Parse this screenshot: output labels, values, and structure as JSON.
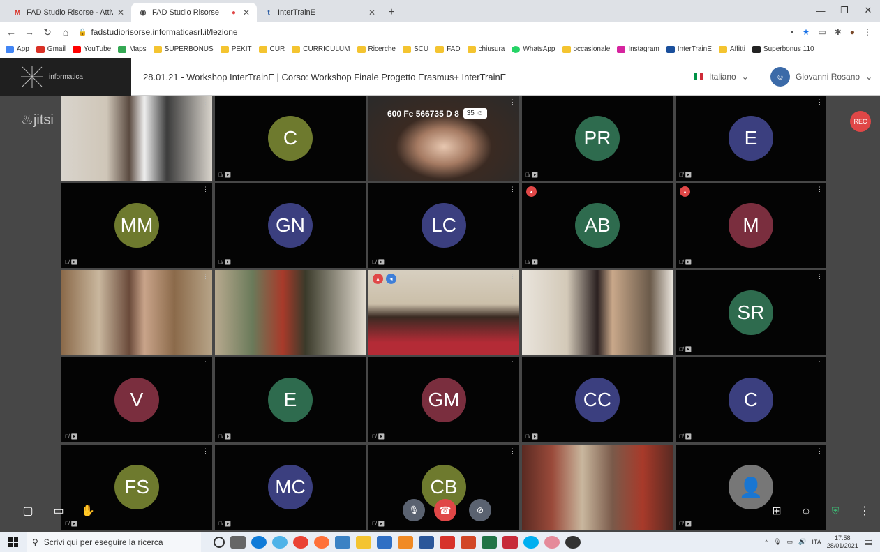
{
  "browser": {
    "tabs": [
      {
        "label": "FAD Studio Risorse - Attivazione",
        "favicon": "gmail-icon",
        "active": false
      },
      {
        "label": "FAD Studio Risorse",
        "favicon": "page-icon",
        "active": true
      },
      {
        "label": "InterTrainE",
        "favicon": "intertraine-icon",
        "active": false
      }
    ],
    "url": "fadstudiorisorse.informaticasrl.it/lezione",
    "bookmarks": [
      "App",
      "Gmail",
      "YouTube",
      "Maps",
      "SUPERBONUS",
      "PEKIT",
      "CUR",
      "CURRICULUM",
      "Ricerche",
      "SCU",
      "FAD",
      "chiusura",
      "WhatsApp",
      "occasionale",
      "Instagram",
      "InterTrainE",
      "Affitti",
      "Superbonus 110"
    ]
  },
  "header": {
    "logo_text": "informatica",
    "course_title": "28.01.21 - Workshop InterTrainE | Corso: Workshop Finale Progetto Erasmus+ InterTrainE",
    "language": "Italiano",
    "user_name": "Giovanni Rosano"
  },
  "meeting": {
    "brand": "jitsi",
    "rec_label": "REC",
    "participant_overlay": "600 Fe 566735 D 8",
    "participant_count": "35",
    "tiles": [
      {
        "initials": "",
        "color": "#2a2a2a",
        "video": "woman-mask"
      },
      {
        "initials": "C",
        "color": "#6e7a2e"
      },
      {
        "initials": "",
        "color": "#2a2a2a",
        "video": "woman"
      },
      {
        "initials": "PR",
        "color": "#2e6b4e"
      },
      {
        "initials": "E",
        "color": "#3b3f7f"
      },
      {
        "initials": "MM",
        "color": "#6e7a2e"
      },
      {
        "initials": "GN",
        "color": "#3b3f7f"
      },
      {
        "initials": "LC",
        "color": "#3b3f7f"
      },
      {
        "initials": "AB",
        "color": "#2e6b4e"
      },
      {
        "initials": "M",
        "color": "#7a2e3e"
      },
      {
        "initials": "",
        "color": "#2a2a2a",
        "video": "man-books"
      },
      {
        "initials": "",
        "color": "#2a2a2a",
        "video": "woman-hat"
      },
      {
        "initials": "",
        "color": "#2a2a2a",
        "video": "woman-speaking"
      },
      {
        "initials": "",
        "color": "#2a2a2a",
        "video": "woman-office"
      },
      {
        "initials": "SR",
        "color": "#2e6b4e"
      },
      {
        "initials": "V",
        "color": "#7a2e3e"
      },
      {
        "initials": "E",
        "color": "#2e6b4e"
      },
      {
        "initials": "GM",
        "color": "#7a2e3e"
      },
      {
        "initials": "CC",
        "color": "#3b3f7f"
      },
      {
        "initials": "C",
        "color": "#3b3f7f"
      },
      {
        "initials": "FS",
        "color": "#6e7a2e"
      },
      {
        "initials": "MC",
        "color": "#3b3f7f"
      },
      {
        "initials": "CB",
        "color": "#6e7a2e"
      },
      {
        "initials": "",
        "color": "#2a2a2a",
        "video": "woman-library"
      },
      {
        "initials": "",
        "color": "#777777",
        "video": "placeholder"
      }
    ]
  },
  "taskbar": {
    "search_placeholder": "Scrivi qui per eseguire la ricerca",
    "lang": "ITA",
    "time": "17:58",
    "date": "28/01/2021"
  }
}
